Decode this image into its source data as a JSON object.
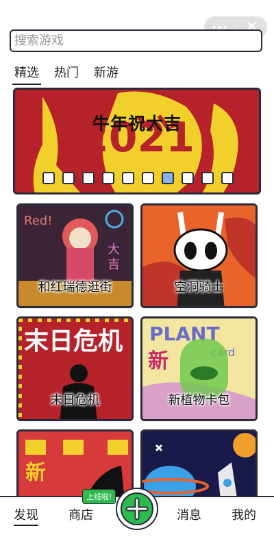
{
  "search": {
    "placeholder": "搜索游戏"
  },
  "tabs": [
    {
      "label": "精选",
      "active": true
    },
    {
      "label": "热门",
      "active": false
    },
    {
      "label": "新游",
      "active": false
    }
  ],
  "banner": {
    "title": "牛年祝大吉",
    "total_slides": 10,
    "active_slide": 7
  },
  "games": [
    {
      "title": "和红瑞德逛街"
    },
    {
      "title": "空洞骑士"
    },
    {
      "title": "末日危机"
    },
    {
      "title": "新植物卡包"
    },
    {
      "title": ""
    },
    {
      "title": ""
    }
  ],
  "bottom_nav": {
    "discover": "发现",
    "shop": "商店",
    "shop_badge": "上线啦!",
    "messages": "消息",
    "me": "我的"
  },
  "colors": {
    "accent_green": "#2ebb4e",
    "outline": "#2a2a3a",
    "banner_red": "#b5222a"
  }
}
